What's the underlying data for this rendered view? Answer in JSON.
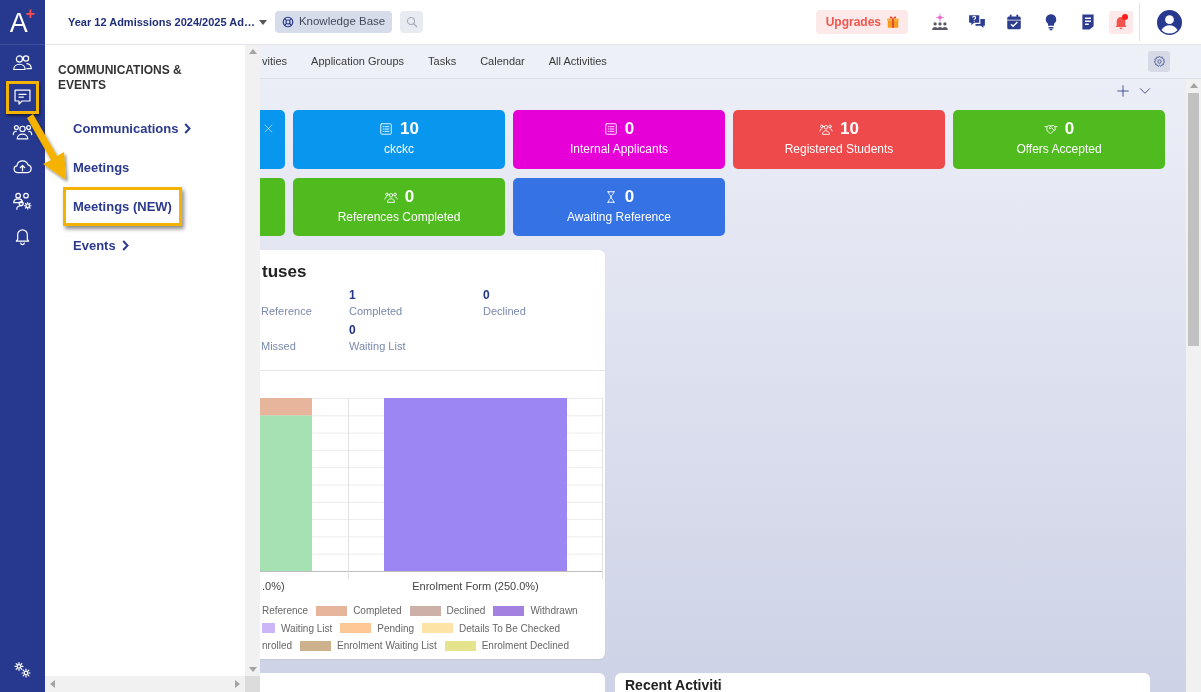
{
  "sidebar": {
    "logo": "A$^{+}$",
    "items": [
      {
        "highlighted": false
      },
      {
        "highlighted": true
      },
      {
        "highlighted": false
      },
      {
        "highlighted": false
      },
      {
        "highlighted": false
      },
      {
        "highlighted": false
      }
    ]
  },
  "topbar": {
    "program": "Year 12 Admissions 2024/2025 Ad…",
    "knowledge_base": "Knowledge Base",
    "upgrades": "Upgrades",
    "notifications": {
      "unread": true
    }
  },
  "flyout": {
    "title": "COMMUNICATIONS & EVENTS",
    "items": [
      {
        "label": "Communications",
        "submenu": true,
        "highlighted": false
      },
      {
        "label": "Meetings",
        "submenu": false,
        "highlighted": false
      },
      {
        "label": "Meetings (NEW)",
        "submenu": false,
        "highlighted": true
      },
      {
        "label": "Events",
        "submenu": true,
        "highlighted": false
      }
    ]
  },
  "tabs": [
    {
      "label": "vities",
      "selected": false
    },
    {
      "label": "Application Groups",
      "selected": false
    },
    {
      "label": "Tasks",
      "selected": false
    },
    {
      "label": "Calendar",
      "selected": false
    },
    {
      "label": "All Activities",
      "selected": false
    }
  ],
  "tile_rows": [
    [
      {
        "kind": "partial",
        "color": "#0996ee",
        "closable": true
      },
      {
        "kind": "count",
        "value": "10",
        "label": "ckckc",
        "color": "#0996ee",
        "closable": false
      },
      {
        "kind": "count",
        "value": "0",
        "label": "Internal Applicants",
        "color": "#e600d7",
        "closable": false
      },
      {
        "kind": "count",
        "value": "10",
        "label": "Registered Students",
        "color": "#ee4a4c",
        "closable": false
      },
      {
        "kind": "count",
        "value": "0",
        "label": "Offers Accepted",
        "color": "#4fbb1e",
        "closable": false
      }
    ],
    [
      {
        "kind": "partial",
        "color": "#4fbb1e",
        "closable": false
      },
      {
        "kind": "count",
        "value": "0",
        "label": "References Completed",
        "color": "#4fbb1e",
        "closable": false
      },
      {
        "kind": "count",
        "value": "0",
        "label": "Awaiting Reference",
        "color": "#3573e4",
        "closable": false
      }
    ]
  ],
  "status_panel": {
    "title": "tuses",
    "stats": [
      {
        "label": "Reference"
      },
      {
        "value": "1",
        "label": "Completed"
      },
      {
        "value": "0",
        "label": "Declined"
      },
      {
        "label": "Missed"
      },
      {
        "value": "0",
        "label": "Waiting List"
      }
    ],
    "chart": {
      "bars": [
        {
          "label": ".0%)",
          "segments": [
            {
              "color": "#a5e1b1"
            },
            {
              "color": "#e6b59b"
            }
          ]
        },
        {
          "label": "Enrolment Form (250.0%)",
          "segments": [
            {
              "color": "#9b86f3"
            }
          ]
        }
      ],
      "legend": [
        [
          {
            "label": "Reference"
          },
          {
            "label": "Completed",
            "color": "#e6b59b"
          },
          {
            "label": "Declined",
            "color": "#cdb1a9"
          },
          {
            "label": "Withdrawn",
            "color": "#a281e0"
          }
        ],
        [
          {
            "label": "Waiting List",
            "color": "#cdb6f7"
          },
          {
            "label": "Pending",
            "color": "#fdc896"
          },
          {
            "label": "Details To Be Checked",
            "color": "#fde4a6"
          }
        ],
        [
          {
            "label": "nrolled"
          },
          {
            "label": "Enrolment Waiting List",
            "color": "#ccb18c"
          },
          {
            "label": "Enrolment Declined",
            "color": "#e5e48c"
          }
        ]
      ]
    }
  },
  "recent_panel": {
    "title": "Recent Activiti"
  }
}
